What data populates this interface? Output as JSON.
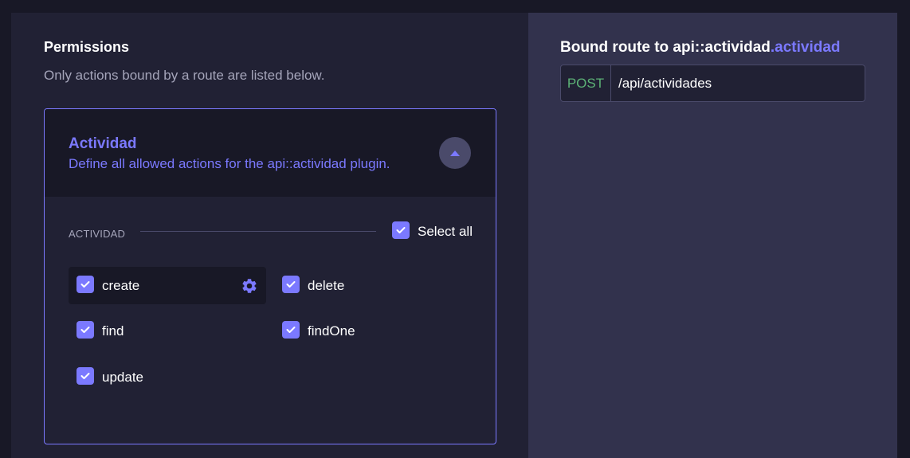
{
  "permissions": {
    "title": "Permissions",
    "subtitle": "Only actions bound by a route are listed below.",
    "card": {
      "title": "Actividad",
      "description": "Define all allowed actions for the api::actividad plugin.",
      "section_label": "ACTIVIDAD",
      "select_all_label": "Select all",
      "select_all_checked": true,
      "actions": [
        {
          "label": "create",
          "checked": true,
          "selected": true
        },
        {
          "label": "delete",
          "checked": true
        },
        {
          "label": "find",
          "checked": true
        },
        {
          "label": "findOne",
          "checked": true
        },
        {
          "label": "update",
          "checked": true
        }
      ]
    }
  },
  "route": {
    "title_prefix": "Bound route to api::actividad",
    "title_accent": ".actividad",
    "method": "POST",
    "path": "/api/actividades"
  },
  "colors": {
    "accent": "#7b79ff",
    "method_post": "#5cb176"
  },
  "icons": [
    "chevron-up-icon",
    "check-icon",
    "gear-icon"
  ]
}
